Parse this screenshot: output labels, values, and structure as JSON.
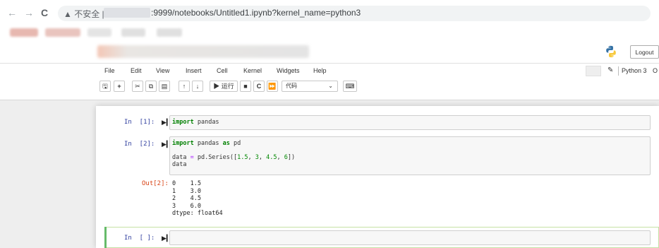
{
  "browser": {
    "nav": {
      "back": "←",
      "forward": "→",
      "reload": "C"
    },
    "security_label": "▲ 不安全 |",
    "url": ":9999/notebooks/Untitled1.ipynb?kernel_name=python3"
  },
  "header": {
    "logout_label": "Logout"
  },
  "menu": {
    "items": [
      "File",
      "Edit",
      "View",
      "Insert",
      "Cell",
      "Kernel",
      "Widgets",
      "Help"
    ],
    "kernel_name": "Python 3",
    "kernel_indicator": "O"
  },
  "toolbar": {
    "run_label": "▶ 运行",
    "cell_type": "代码"
  },
  "cells": [
    {
      "prompt": "In  [1]:",
      "lines": [
        "import pandas"
      ]
    },
    {
      "prompt": "In  [2]:",
      "lines": [
        "import pandas as pd",
        "",
        "data = pd.Series([1.5, 3, 4.5, 6])",
        "data"
      ]
    },
    {
      "prompt": "In  [ ]:",
      "lines": [
        ""
      ]
    }
  ],
  "output": {
    "prompt": "Out[2]:",
    "lines": [
      "0    1.5",
      "1    3.0",
      "2    4.5",
      "3    6.0",
      "dtype: float64"
    ]
  }
}
